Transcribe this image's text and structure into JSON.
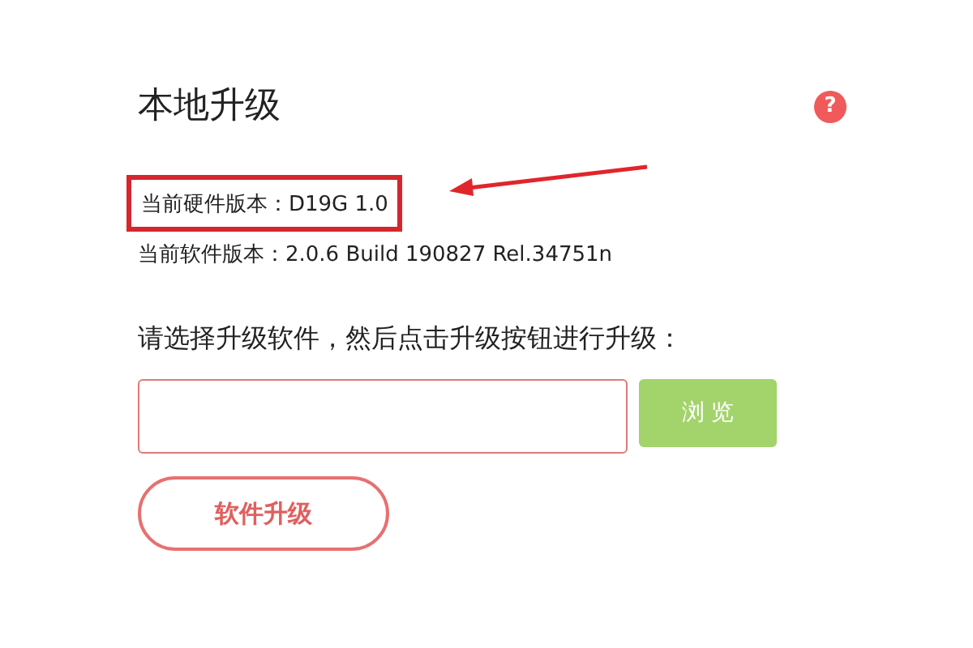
{
  "title": "本地升级",
  "help": {
    "glyph": "?"
  },
  "hardware_version": {
    "text": "当前硬件版本：D19G 1.0",
    "highlighted": true
  },
  "software_version": "当前软件版本：2.0.6 Build 190827 Rel.34751n",
  "prompt": "请选择升级软件，然后点击升级按钮进行升级：",
  "browse_button": "浏 览",
  "upgrade_button": "软件升级"
}
